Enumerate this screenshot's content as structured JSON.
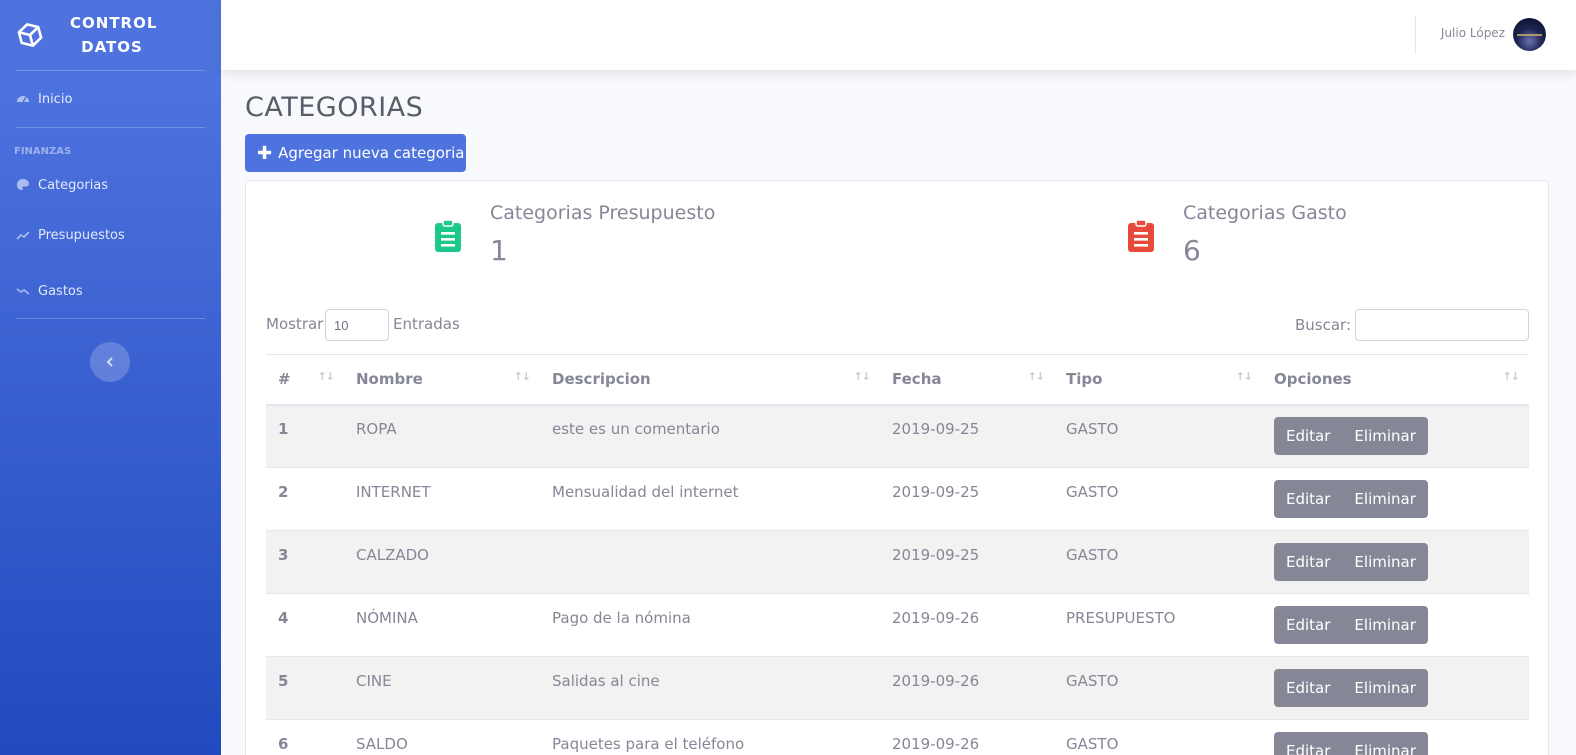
{
  "brand": {
    "line1": "CONTROL",
    "line2": "DATOS"
  },
  "sidebar": {
    "inicio": "Inicio",
    "heading": "FINANZAS",
    "items": [
      {
        "label": "Categorias",
        "icon": "palette-icon"
      },
      {
        "label": "Presupuestos",
        "icon": "chart-line-up-icon"
      },
      {
        "label": "Gastos",
        "icon": "chart-line-down-icon"
      }
    ]
  },
  "topbar": {
    "user_name": "Julio López"
  },
  "page": {
    "title": "CATEGORIAS",
    "add_button": "Agregar nueva categoria"
  },
  "stats": [
    {
      "label": "Categorias Presupuesto",
      "value": "1",
      "color": "#1cc88a"
    },
    {
      "label": "Categorias Gasto",
      "value": "6",
      "color": "#e74a3b"
    }
  ],
  "table_controls": {
    "show": "Mostrar",
    "length": "10",
    "entries": "Entradas",
    "search": "Buscar:"
  },
  "table": {
    "headers": [
      "#",
      "Nombre",
      "Descripcion",
      "Fecha",
      "Tipo",
      "Opciones"
    ],
    "rows": [
      {
        "id": "1",
        "nombre": "ROPA",
        "descripcion": "este es un comentario",
        "fecha": "2019-09-25",
        "tipo": "GASTO"
      },
      {
        "id": "2",
        "nombre": "INTERNET",
        "descripcion": "Mensualidad del internet",
        "fecha": "2019-09-25",
        "tipo": "GASTO"
      },
      {
        "id": "3",
        "nombre": "CALZADO",
        "descripcion": "",
        "fecha": "2019-09-25",
        "tipo": "GASTO"
      },
      {
        "id": "4",
        "nombre": "NÓMINA",
        "descripcion": "Pago de la nómina",
        "fecha": "2019-09-26",
        "tipo": "PRESUPUESTO"
      },
      {
        "id": "5",
        "nombre": "CINE",
        "descripcion": "Salidas al cine",
        "fecha": "2019-09-26",
        "tipo": "GASTO"
      },
      {
        "id": "6",
        "nombre": "SALDO",
        "descripcion": "Paquetes para el teléfono",
        "fecha": "2019-09-26",
        "tipo": "GASTO"
      }
    ],
    "edit_label": "Editar",
    "delete_label": "Eliminar"
  }
}
